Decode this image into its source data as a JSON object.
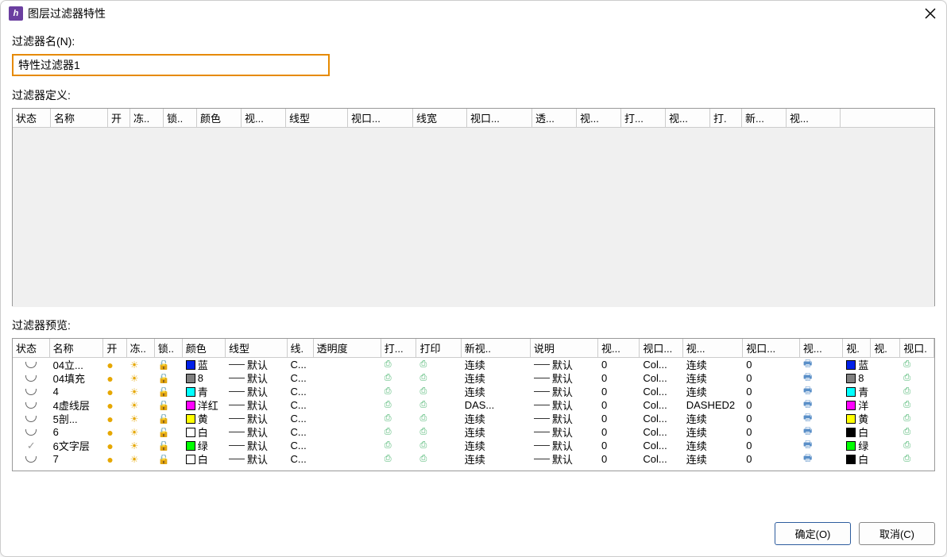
{
  "title": "图层过滤器特性",
  "labels": {
    "filter_name": "过滤器名(N):",
    "filter_def": "过滤器定义:",
    "filter_preview": "过滤器预览:"
  },
  "filter_name_value": "特性过滤器1",
  "buttons": {
    "ok": "确定(O)",
    "cancel": "取消(C)"
  },
  "def_columns": [
    "状态",
    "名称",
    "开",
    "冻..",
    "锁..",
    "颜色",
    "视...",
    "线型",
    "视口...",
    "线宽",
    "视口...",
    "透...",
    "视...",
    "打...",
    "视...",
    "打.",
    "新...",
    "视..."
  ],
  "preview_columns": [
    "状态",
    "名称",
    "开",
    "冻..",
    "锁..",
    "颜色",
    "线型",
    "线.",
    "透明度",
    "打...",
    "打印",
    "新视..",
    "说明",
    "视...",
    "视口...",
    "视...",
    "视口...",
    "视...",
    "视.",
    "视.",
    "视口."
  ],
  "colors": {
    "blue": "#0020e8",
    "gray": "#808080",
    "cyan": "#00ffff",
    "magenta": "#ff00ff",
    "yellow": "#ffff00",
    "white": "#ffffff",
    "green": "#00ff00",
    "black": "#000000"
  },
  "preview_rows": [
    {
      "status": "shape",
      "name": "04立...",
      "c": "blue",
      "cname": "蓝",
      "line_vp": "连续",
      "lt2": "连续",
      "c2": "blue",
      "c2name": "蓝"
    },
    {
      "status": "shape",
      "name": "04填充",
      "c": "gray",
      "cname": "8",
      "line_vp": "连续",
      "lt2": "连续",
      "c2": "gray",
      "c2name": "8"
    },
    {
      "status": "shape",
      "name": "4",
      "c": "cyan",
      "cname": "青",
      "line_vp": "连续",
      "lt2": "连续",
      "c2": "cyan",
      "c2name": "青"
    },
    {
      "status": "shape",
      "name": "4虚线层",
      "c": "magenta",
      "cname": "洋红",
      "line_vp": "DAS...",
      "lt2": "DASHED2",
      "c2": "magenta",
      "c2name": "洋"
    },
    {
      "status": "shape",
      "name": "5剖...",
      "c": "yellow",
      "cname": "黄",
      "line_vp": "连续",
      "lt2": "连续",
      "c2": "yellow",
      "c2name": "黄"
    },
    {
      "status": "shape",
      "name": "6",
      "c": "white",
      "cname": "白",
      "line_vp": "连续",
      "lt2": "连续",
      "c2": "black",
      "c2name": "白"
    },
    {
      "status": "check",
      "name": "6文字层",
      "c": "green",
      "cname": "绿",
      "line_vp": "连续",
      "lt2": "连续",
      "c2": "green",
      "c2name": "绿"
    },
    {
      "status": "shape",
      "name": "7",
      "c": "white",
      "cname": "白",
      "line_vp": "连续",
      "lt2": "连续",
      "c2": "black",
      "c2name": "白"
    }
  ],
  "common": {
    "linetype": "默认",
    "lineprefix": "C...",
    "lineweight": "默认",
    "transparency": "0",
    "plotstyle": "Col...",
    "zero": "0"
  }
}
